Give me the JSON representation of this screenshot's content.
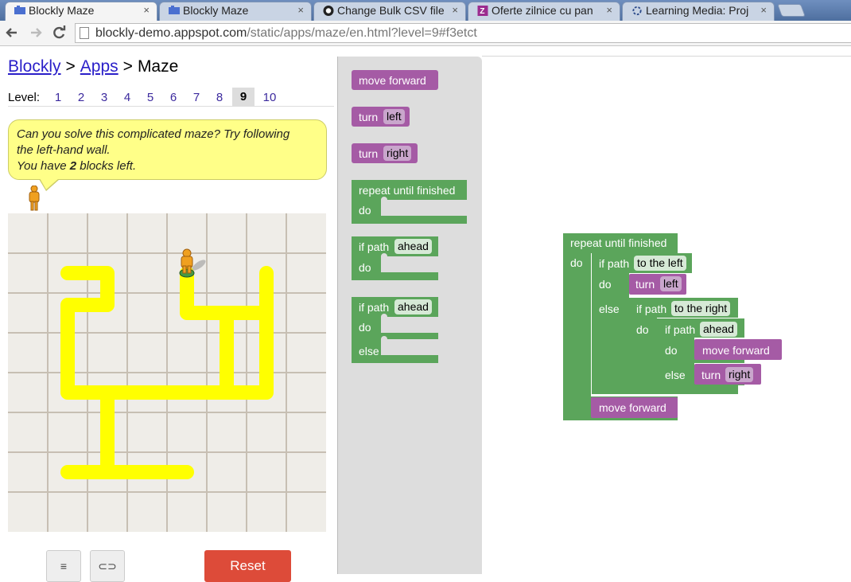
{
  "browser": {
    "tabs": [
      {
        "title": "Blockly Maze",
        "active": true
      },
      {
        "title": "Blockly Maze",
        "active": false
      },
      {
        "title": "Change Bulk CSV file",
        "active": false
      },
      {
        "title": "Oferte zilnice cu pan",
        "active": false
      },
      {
        "title": "Learning Media: Proj",
        "active": false
      }
    ],
    "close_glyph": "×",
    "url_host": "blockly-demo.appspot.com",
    "url_path": "/static/apps/maze/en.html?level=9#f3etct"
  },
  "breadcrumb": {
    "blockly": "Blockly",
    "sep": ">",
    "apps": "Apps",
    "page": "Maze"
  },
  "levels": {
    "label": "Level:",
    "items": [
      "1",
      "2",
      "3",
      "4",
      "5",
      "6",
      "7",
      "8",
      "9",
      "10"
    ],
    "current": "9"
  },
  "hint": {
    "line1": "Can you solve this complicated maze? Try following",
    "line2": "the left-hand wall.",
    "line3_pre": "You have ",
    "line3_count": "2",
    "line3_post": " blocks left."
  },
  "buttons": {
    "reset": "Reset",
    "code_glyph": "≡",
    "link_glyph": "⊂⊃"
  },
  "toolbox": {
    "move_forward": "move forward",
    "turn": "turn",
    "left": "left",
    "right": "right",
    "repeat_until": "repeat until finished",
    "do": "do",
    "else": "else",
    "if_path": "if path",
    "ahead": "ahead"
  },
  "workspace": {
    "repeat_until": "repeat until finished",
    "do": "do",
    "else": "else",
    "if_path": "if path",
    "to_the_left": "to the left",
    "to_the_right": "to the right",
    "ahead": "ahead",
    "turn": "turn",
    "left": "left",
    "right": "right",
    "move_forward": "move forward"
  },
  "colors": {
    "motion_block": "#a55ba5",
    "logic_block": "#5ba55b",
    "path": "#ffff00",
    "reset": "#dd4b39"
  }
}
